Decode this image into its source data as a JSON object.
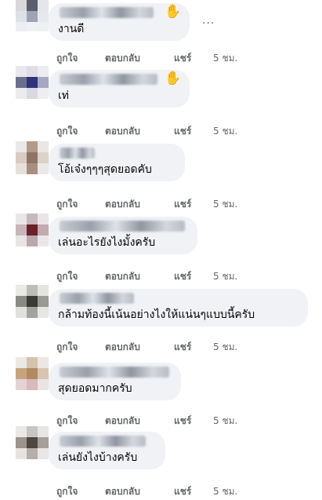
{
  "actions": {
    "like": "ถูกใจ",
    "reply": "ตอบกลับ",
    "share": "แชร์",
    "time": "5 ชม."
  },
  "comments": [
    {
      "text": "งานดี",
      "badge": "wave-hand-icon",
      "has_more_menu": true,
      "more": "..."
    },
    {
      "text": "เท่",
      "badge": "wave-hand-icon"
    },
    {
      "text": "โอ้เจ๋งๆๆๆสุดยอดคับ"
    },
    {
      "text": "เล่นอะไรยังไงมั้งครับ"
    },
    {
      "text": "กล้ามท้องนี้เน้นอย่างไงให้แน่นๆแบบนี้ครับ"
    },
    {
      "text": "สุดยอดมากครับ"
    },
    {
      "text": "เล่นยังไงบ้างครับ"
    }
  ],
  "colors": {
    "bubble": "#f0f2f5",
    "meta_text": "#65676b",
    "comment_text": "#050505"
  }
}
